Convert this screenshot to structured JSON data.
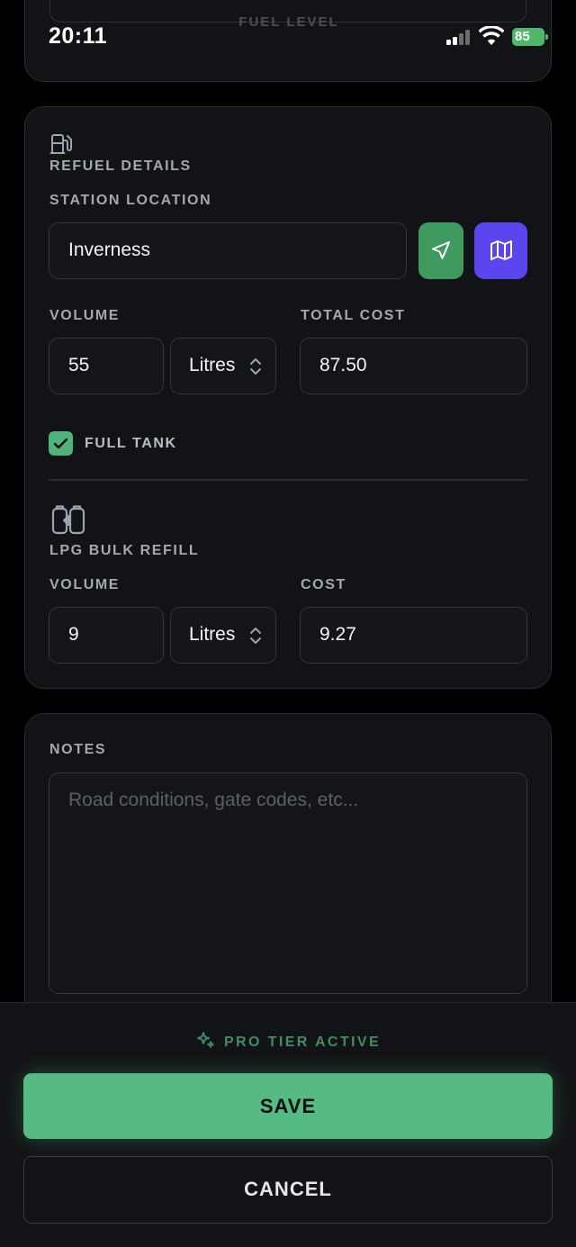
{
  "status_bar": {
    "time": "20:11",
    "battery": "85"
  },
  "fuel_level": {
    "label": "FUEL LEVEL"
  },
  "refuel": {
    "title": "REFUEL DETAILS",
    "station_label": "STATION LOCATION",
    "station_value": "Inverness",
    "volume_label": "VOLUME",
    "volume_value": "55",
    "volume_unit": "Litres",
    "total_cost_label": "TOTAL COST",
    "total_cost_value": "87.50",
    "full_tank_label": "FULL TANK",
    "full_tank_checked": true
  },
  "lpg": {
    "title": "LPG BULK REFILL",
    "volume_label": "VOLUME",
    "volume_value": "9",
    "volume_unit": "Litres",
    "cost_label": "COST",
    "cost_value": "9.27"
  },
  "notes": {
    "label": "NOTES",
    "placeholder": "Road conditions, gate codes, etc..."
  },
  "footer": {
    "pro_label": "PRO TIER ACTIVE",
    "save_label": "SAVE",
    "cancel_label": "CANCEL"
  },
  "colors": {
    "accent_green": "#56bb82",
    "map_button": "#5b45ef",
    "locate_button": "#3f9a60"
  }
}
